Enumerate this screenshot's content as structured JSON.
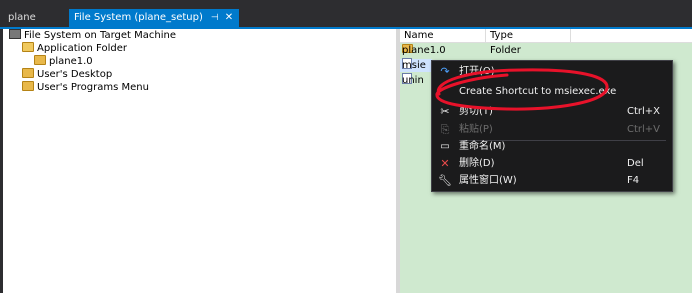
{
  "tabs": [
    {
      "label": "plane",
      "active": false
    },
    {
      "label": "File System (plane_setup)",
      "active": true,
      "pin": "⊣",
      "close": "✕"
    }
  ],
  "tree": {
    "root": "File System on Target Machine",
    "app_folder": "Application Folder",
    "child": "plane1.0",
    "desktop": "User's Desktop",
    "programs": "User's Programs Menu"
  },
  "list": {
    "columns": [
      "Name",
      "Type"
    ],
    "rows": [
      {
        "name": "plane1.0",
        "type": "Folder"
      },
      {
        "name": "msie",
        "type": ""
      },
      {
        "name": "unin",
        "type": ""
      }
    ]
  },
  "context_menu": {
    "items": [
      {
        "label": "打开(O)",
        "shortcut": "",
        "icon": "open-icon",
        "disabled": false
      },
      {
        "label": "Create Shortcut to msiexec.exe",
        "shortcut": "",
        "icon": "",
        "disabled": false
      },
      {
        "label": "剪切(T)",
        "shortcut": "Ctrl+X",
        "icon": "scissors-icon",
        "disabled": false
      },
      {
        "label": "粘贴(P)",
        "shortcut": "Ctrl+V",
        "icon": "paste-icon",
        "disabled": true
      },
      {
        "label": "重命名(M)",
        "shortcut": "",
        "icon": "rename-icon",
        "disabled": false
      },
      {
        "label": "删除(D)",
        "shortcut": "Del",
        "icon": "delete-icon",
        "disabled": false
      },
      {
        "label": "属性窗口(W)",
        "shortcut": "F4",
        "icon": "wrench-icon",
        "disabled": false
      }
    ]
  },
  "colors": {
    "accent": "#007acc",
    "annotation": "#e8122a",
    "list_bg": "#cfe9cf"
  }
}
